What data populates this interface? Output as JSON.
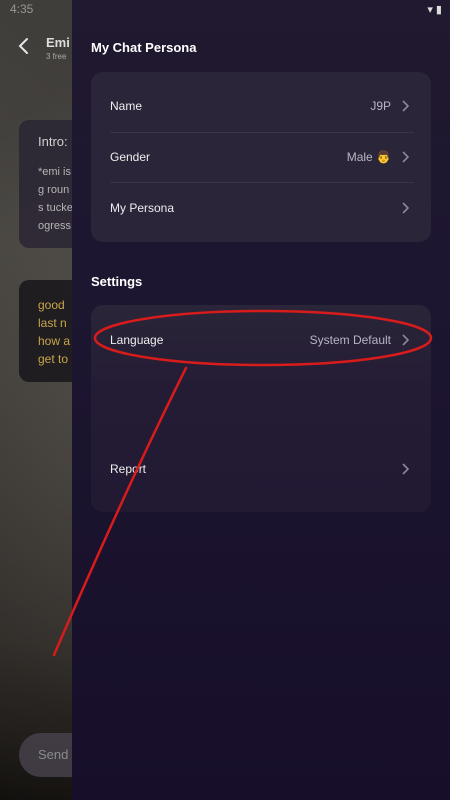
{
  "status_bar": {
    "time": "4:35",
    "icons": "▾ ▮"
  },
  "chat": {
    "name": "Emi",
    "subtitle": "3 free",
    "intro_title": "Intro:",
    "intro_lines": [
      "*emi is",
      "g roun",
      "s tucke",
      "ogress"
    ],
    "user_lines": [
      "good",
      "last n",
      "how a",
      "get to"
    ],
    "input_placeholder": "Send"
  },
  "drawer": {
    "persona_section": "My Chat Persona",
    "persona_rows": [
      {
        "label": "Name",
        "value": "J9P"
      },
      {
        "label": "Gender",
        "value": "Male 👨"
      },
      {
        "label": "My Persona",
        "value": ""
      }
    ],
    "settings_section": "Settings",
    "settings_rows": [
      {
        "label": "Language",
        "value": "System Default"
      },
      {
        "label": "Report",
        "value": ""
      }
    ]
  },
  "colors": {
    "annotation": "#d81b1b",
    "drawer_bg": "#1c1530",
    "card_bg": "#2a2538"
  }
}
